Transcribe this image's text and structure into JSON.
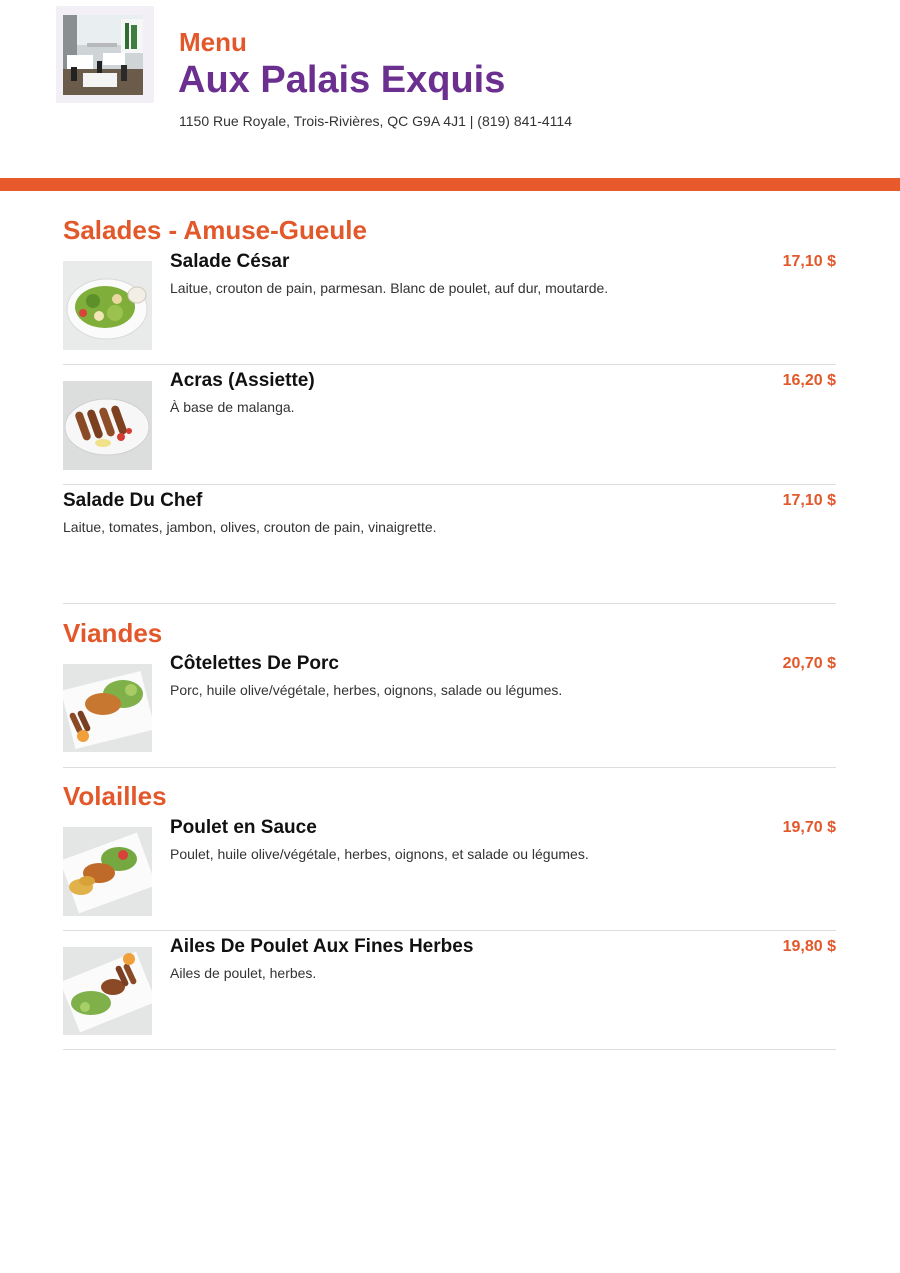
{
  "header": {
    "kicker": "Menu",
    "restaurant_name": "Aux Palais Exquis",
    "address_line": "1150 Rue Royale, Trois-Rivières, QC G9A 4J1 | (819) 841-4114",
    "logo_icon": "restaurant-interior-photo"
  },
  "colors": {
    "accent": "#e2582a",
    "brand": "#6a2f8f",
    "bar": "#e85a2b",
    "divider": "#dddddd"
  },
  "sections": [
    {
      "title": "Salades - Amuse-Gueule",
      "items": [
        {
          "name": "Salade César",
          "description": "Laitue, crouton de pain, parmesan. Blanc de poulet, auf dur, moutarde.",
          "price": "17,10 $",
          "image": "salad-plate-photo"
        },
        {
          "name": "Acras (Assiette)",
          "description": "À base de malanga.",
          "price": "16,20 $",
          "image": "fritters-plate-photo"
        },
        {
          "name": "Salade Du Chef",
          "description": "Laitue, tomates, jambon, olives, crouton de pain, vinaigrette.",
          "price": "17,10 $"
        }
      ]
    },
    {
      "title": "Viandes",
      "items": [
        {
          "name": "Côtelettes De Porc",
          "description": "Porc, huile olive/végétale, herbes, oignons, salade ou légumes.",
          "price": "20,70 $",
          "image": "pork-chops-photo"
        }
      ]
    },
    {
      "title": "Volailles",
      "items": [
        {
          "name": "Poulet en Sauce",
          "description": "Poulet, huile olive/végétale, herbes, oignons, et salade ou légumes.",
          "price": "19,70 $",
          "image": "chicken-sauce-photo"
        },
        {
          "name": "Ailes De Poulet Aux Fines Herbes",
          "description": "Ailes de poulet, herbes.",
          "price": "19,80 $",
          "image": "chicken-wings-photo"
        }
      ]
    }
  ]
}
